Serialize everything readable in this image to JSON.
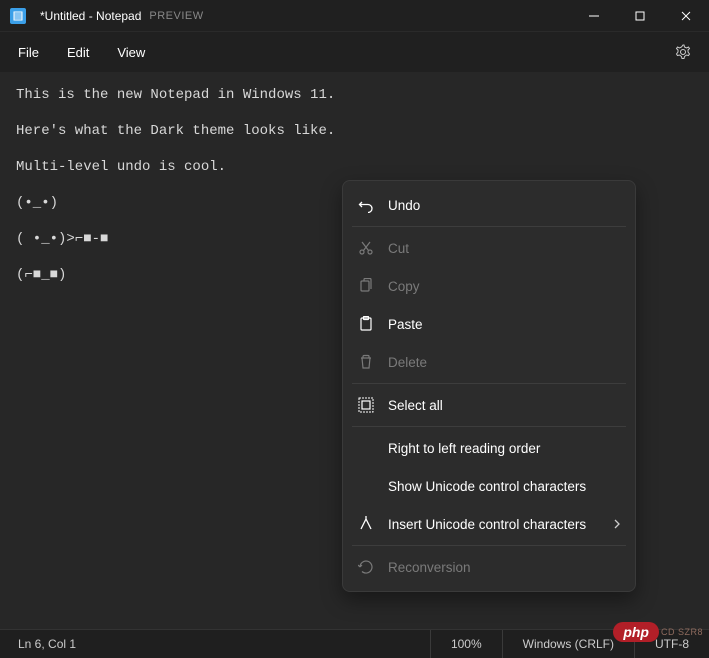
{
  "titlebar": {
    "title": "*Untitled - Notepad",
    "badge": "PREVIEW"
  },
  "menu": {
    "file": "File",
    "edit": "Edit",
    "view": "View"
  },
  "editor": {
    "content": "This is the new Notepad in Windows 11.\n\nHere's what the Dark theme looks like.\n\nMulti-level undo is cool.\n\n(•_•)\n\n( •_•)>⌐■-■\n\n(⌐■_■)"
  },
  "context_menu": {
    "undo": "Undo",
    "cut": "Cut",
    "copy": "Copy",
    "paste": "Paste",
    "delete": "Delete",
    "select_all": "Select all",
    "rtl": "Right to left reading order",
    "unicode_show": "Show Unicode control characters",
    "unicode_insert": "Insert Unicode control characters",
    "reconversion": "Reconversion"
  },
  "statusbar": {
    "position": "Ln 6, Col 1",
    "zoom": "100%",
    "line_ending": "Windows (CRLF)",
    "encoding": "UTF-8"
  },
  "watermark": {
    "brand": "php",
    "suffix": "CD SZR8"
  }
}
